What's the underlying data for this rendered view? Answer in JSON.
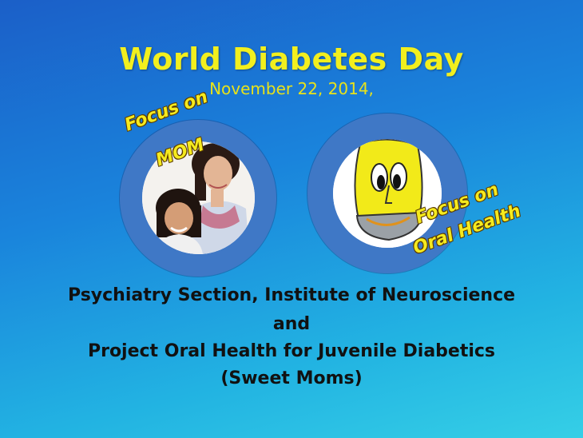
{
  "header": {
    "title": "World Diabetes Day",
    "date": "November 22, 2014,"
  },
  "badges": {
    "mom_line1": "Focus on",
    "mom_line2": "MOM",
    "oral_line1": "Focus on",
    "oral_line2": "Oral Health"
  },
  "body": {
    "line1": "Psychiatry Section, Institute of Neuroscience",
    "line2": "and",
    "line3": "Project Oral Health for Juvenile Diabetics",
    "line4": "(Sweet Moms)"
  },
  "colors": {
    "title": "#f2ef1e",
    "ring": "#3f78c6",
    "background_top": "#1b5fc8",
    "background_bottom": "#35cfe6"
  },
  "images": {
    "left": "photo of mother and daughter",
    "right": "cartoon tooth mascot"
  }
}
